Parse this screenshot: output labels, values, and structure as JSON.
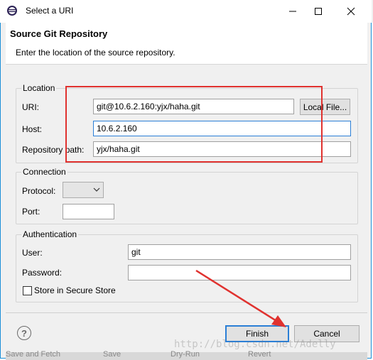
{
  "window": {
    "title": "Select a URI"
  },
  "header": {
    "title": "Source Git Repository",
    "description": "Enter the location of the source repository."
  },
  "location": {
    "group_label": "Location",
    "uri_label": "URI:",
    "uri_value": "git@10.6.2.160:yjx/haha.git",
    "local_file_button": "Local File...",
    "host_label": "Host:",
    "host_value": "10.6.2.160",
    "repo_path_label": "Repository path:",
    "repo_path_value": "yjx/haha.git"
  },
  "connection": {
    "group_label": "Connection",
    "protocol_label": "Protocol:",
    "protocol_value": "",
    "port_label": "Port:",
    "port_value": ""
  },
  "authentication": {
    "group_label": "Authentication",
    "user_label": "User:",
    "user_value": "git",
    "password_label": "Password:",
    "password_value": "",
    "store_label": "Store in Secure Store",
    "store_checked": false
  },
  "footer": {
    "finish_label": "Finish",
    "cancel_label": "Cancel",
    "help_symbol": "?"
  },
  "background_behind": {
    "bottom_buttons": [
      "Save and Fetch",
      "Save",
      "Dry-Run",
      "Revert"
    ]
  },
  "watermark": "http://blog.csdn.net/Adelly",
  "colors": {
    "annotation_red": "#e0322f",
    "focus_blue": "#2b7fd6",
    "accent_blue": "#1a8fd8"
  }
}
